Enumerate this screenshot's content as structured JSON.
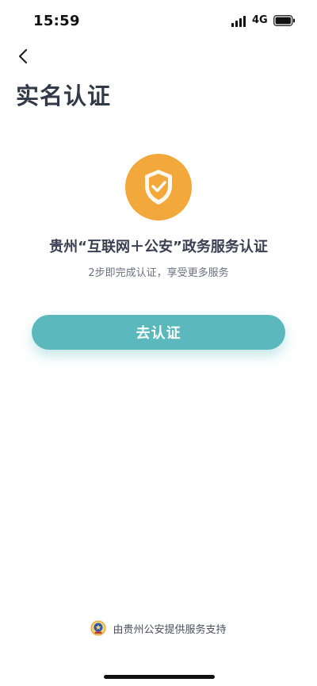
{
  "status_bar": {
    "time": "15:59",
    "network": "4G",
    "signal_icon": "signal-bars-icon",
    "battery_icon": "battery-icon"
  },
  "nav": {
    "back_icon": "chevron-left-icon"
  },
  "page": {
    "title": "实名认证"
  },
  "hero": {
    "icon": "shield-check-icon",
    "icon_color": "#f2a83a",
    "heading": "贵州“互联网＋公安”政务服务认证",
    "subtitle": "2步即完成认证，享受更多服务"
  },
  "action": {
    "verify_label": "去认证",
    "button_color": "#5bb8bd"
  },
  "footer": {
    "emblem_icon": "police-emblem-icon",
    "text": "由贵州公安提供服务支持"
  }
}
